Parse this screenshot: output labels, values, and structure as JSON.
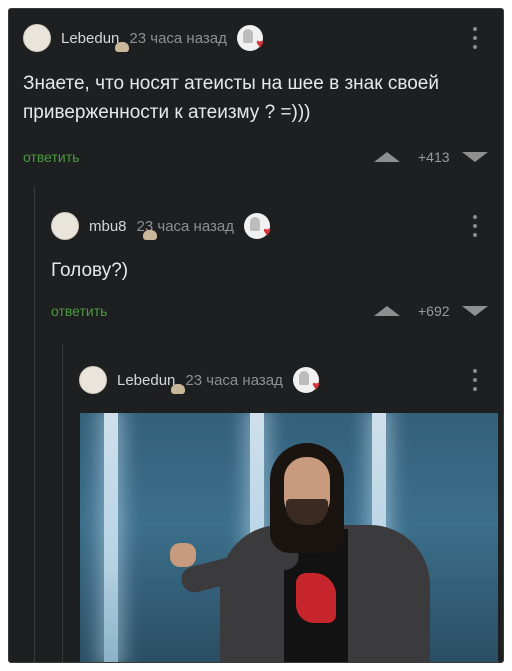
{
  "comments": [
    {
      "username": "Lebedun",
      "time": "23 часа назад",
      "text": "Знаете, что носят атеисты на шее в знак своей приверженности к атеизму ? =)))",
      "reply_label": "ответить",
      "rating": "+413"
    },
    {
      "username": "mbu8",
      "time": "23 часа назад",
      "text": "Голову?)",
      "reply_label": "ответить",
      "rating": "+692"
    },
    {
      "username": "Lebedun",
      "time": "23 часа назад",
      "attachment": "photo of a man with long hair in a dark jacket pointing forward"
    }
  ],
  "colors": {
    "background": "#1e1f21",
    "text": "#e8e8e8",
    "reply_link": "#4a9a3e",
    "meta": "#8e8e8e"
  },
  "icons": [
    "avatar",
    "award-badge-icon",
    "more-vertical-icon",
    "upvote-icon",
    "downvote-icon"
  ]
}
